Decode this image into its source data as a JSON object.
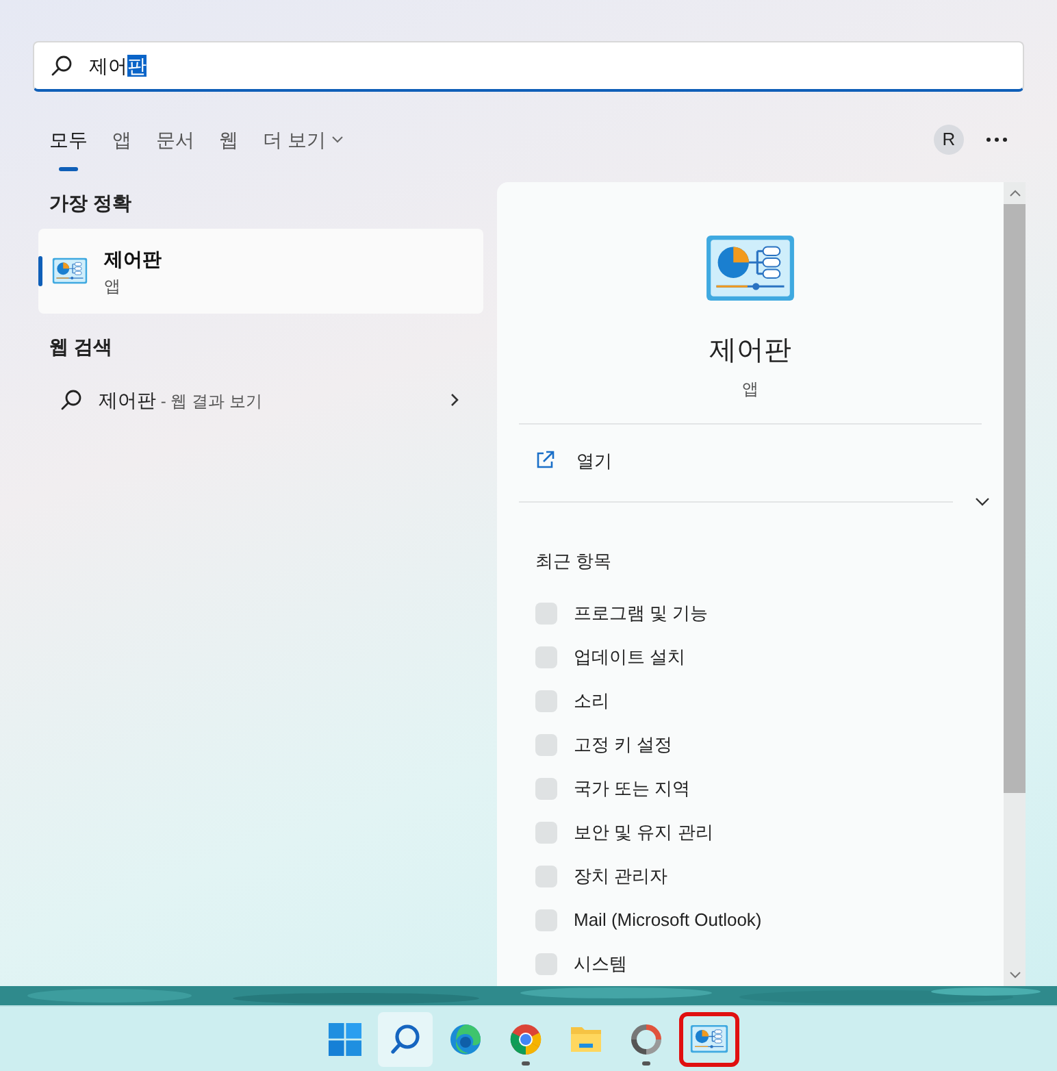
{
  "search": {
    "parts": [
      {
        "text": "제어",
        "selected": false
      },
      {
        "text": "판",
        "selected": true
      }
    ]
  },
  "tabs": [
    {
      "label": "모두",
      "selected": true,
      "dropdown": false
    },
    {
      "label": "앱",
      "selected": false,
      "dropdown": false
    },
    {
      "label": "문서",
      "selected": false,
      "dropdown": false
    },
    {
      "label": "웹",
      "selected": false,
      "dropdown": false
    },
    {
      "label": "더 보기",
      "selected": false,
      "dropdown": true
    }
  ],
  "account": {
    "initial": "R"
  },
  "best_match": {
    "heading": "가장 정확",
    "title": "제어판",
    "subtitle": "앱",
    "selected": true
  },
  "web_search": {
    "heading": "웹 검색",
    "query": "제어판",
    "suffix": " - 웹 결과 보기"
  },
  "detail": {
    "title": "제어판",
    "subtitle": "앱",
    "open_label": "열기",
    "recent_heading": "최근 항목",
    "recent": [
      "프로그램 및 기능",
      "업데이트 설치",
      "소리",
      "고정 키 설정",
      "국가 또는 지역",
      "보안 및 유지 관리",
      "장치 관리자",
      "Mail (Microsoft Outlook)",
      "시스템"
    ]
  },
  "taskbar": [
    {
      "kind": "start",
      "active": false,
      "running": false,
      "highlighted": false
    },
    {
      "kind": "search",
      "active": true,
      "running": false,
      "highlighted": false
    },
    {
      "kind": "edge",
      "active": false,
      "running": false,
      "highlighted": false
    },
    {
      "kind": "chrome",
      "active": false,
      "running": true,
      "highlighted": false
    },
    {
      "kind": "explorer",
      "active": false,
      "running": false,
      "highlighted": false
    },
    {
      "kind": "ring",
      "active": false,
      "running": true,
      "highlighted": false
    },
    {
      "kind": "control",
      "active": false,
      "running": false,
      "highlighted": true
    }
  ]
}
